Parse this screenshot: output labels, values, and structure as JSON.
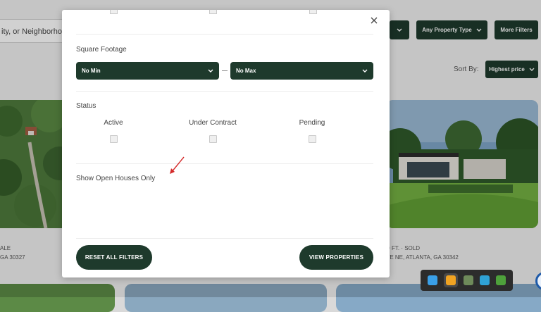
{
  "background": {
    "search_placeholder": "ity, or Neighborhoo",
    "property_type_label": "Any Property Type",
    "more_filters_label": "More Filters",
    "sort_label": "Sort By:",
    "sort_value": "Highest price",
    "card_left_line1": "ALE",
    "card_left_line2": "GA 30327",
    "card_right_line1": "D FT. · SOLD",
    "card_right_line2": "VE NE, ATLANTA, GA 30342"
  },
  "modal": {
    "square_footage_label": "Square Footage",
    "min_select": "No Min",
    "max_select": "No Max",
    "status_label": "Status",
    "status_options": [
      "Active",
      "Under Contract",
      "Pending"
    ],
    "open_houses_label": "Show Open Houses Only",
    "reset_button": "RESET ALL FILTERS",
    "view_button": "VIEW PROPERTIES"
  },
  "colors": {
    "primary": "#1e3a2c",
    "annotation_arrow": "#d42a2a"
  }
}
